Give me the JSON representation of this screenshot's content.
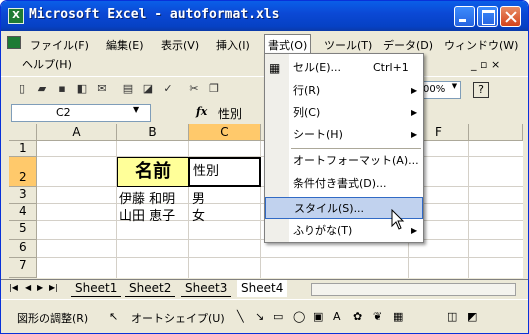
{
  "window": {
    "title": "Microsoft Excel - autoformat.xls"
  },
  "menubar": {
    "items": [
      "ファイル(F)",
      "編集(E)",
      "表示(V)",
      "挿入(I)",
      "書式(O)",
      "ツール(T)",
      "データ(D)",
      "ウィンドウ(W)"
    ],
    "help": "ヘルプ(H)",
    "mdi_controls": "_ ▫ ×"
  },
  "toolbar": {
    "zoom": "00%",
    "help_symbol": "?"
  },
  "formula_bar": {
    "name_box": "C2",
    "fx": "fx",
    "value": "性別"
  },
  "grid": {
    "columns": [
      "A",
      "B",
      "C",
      "F"
    ],
    "rows": [
      "1",
      "2",
      "3",
      "4",
      "5",
      "6",
      "7"
    ],
    "b2": "名前",
    "c2": "性別",
    "b3": "伊藤 和明",
    "c3": "男",
    "b4": "山田 恵子",
    "c4": "女"
  },
  "sheets": {
    "tabs": [
      "Sheet1",
      "Sheet2",
      "Sheet3",
      "Sheet4"
    ],
    "active": "Sheet4"
  },
  "drawing": {
    "adjust": "図形の調整(R)",
    "autoshape": "オートシェイプ(U)"
  },
  "format_menu": {
    "cell": "セル(E)...",
    "cell_shortcut": "Ctrl+1",
    "row": "行(R)",
    "column": "列(C)",
    "sheet": "シート(H)",
    "autoformat": "オートフォーマット(A)...",
    "conditional": "条件付き書式(D)...",
    "style": "スタイル(S)...",
    "furigana": "ふりがな(T)"
  }
}
